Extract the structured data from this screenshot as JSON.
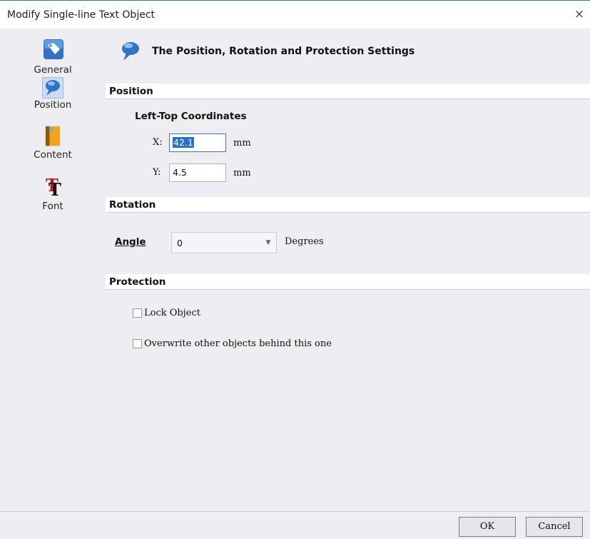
{
  "window": {
    "title": "Modify Single-line Text Object",
    "close_symbol": "×"
  },
  "sidebar": {
    "items": [
      {
        "label": "General",
        "icon": "tag-icon",
        "selected": false
      },
      {
        "label": "Position",
        "icon": "pin-icon",
        "selected": true
      },
      {
        "label": "Content",
        "icon": "book-icon",
        "selected": false
      },
      {
        "label": "Font",
        "icon": "font-tt-icon",
        "selected": false
      }
    ]
  },
  "header": {
    "title": "The Position, Rotation and Protection Settings",
    "icon": "pin-icon"
  },
  "position": {
    "section_label": "Position",
    "subheading": "Left-Top Coordinates",
    "x_label": "X:",
    "x_value": "42.1",
    "y_label": "Y:",
    "y_value": "4.5",
    "unit": "mm"
  },
  "rotation": {
    "section_label": "Rotation",
    "angle_label": "Angle",
    "angle_value": "0",
    "angle_unit": "Degrees"
  },
  "protection": {
    "section_label": "Protection",
    "lock_label": "Lock Object",
    "lock_checked": false,
    "overwrite_label": "Overwrite other objects behind this one",
    "overwrite_checked": false
  },
  "buttons": {
    "ok": "OK",
    "cancel": "Cancel"
  },
  "colors": {
    "accent": "#2a6fd0",
    "section_bg": "#ffffff",
    "dialog_bg": "#eeeef2"
  }
}
